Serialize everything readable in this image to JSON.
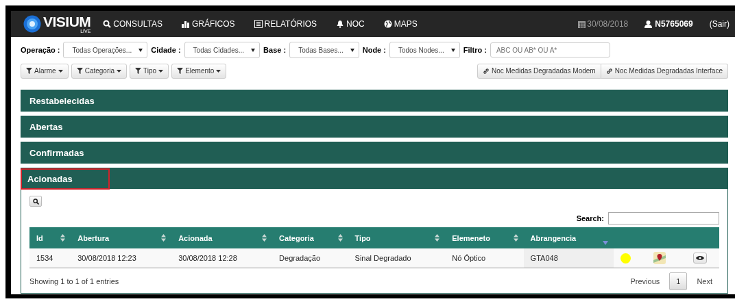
{
  "navbar": {
    "logo": {
      "name": "VISIUM",
      "sub": "LIVE"
    },
    "items": [
      "CONSULTAS",
      "GRÁFICOS",
      "RELATÓRIOS",
      "NOC",
      "MAPS"
    ],
    "date": "30/08/2018",
    "user": "N5765069",
    "logout": "(Sair)"
  },
  "filters": [
    {
      "label": "Operação :",
      "value": "Todas Operações..."
    },
    {
      "label": "Cidade :",
      "value": "Todas Cidades..."
    },
    {
      "label": "Base :",
      "value": "Todas Bases..."
    },
    {
      "label": "Node :",
      "value": "Todos Nodes..."
    }
  ],
  "filter_text": {
    "label": "Filtro :",
    "placeholder": "ABC OU AB* OU A*"
  },
  "dropdown_buttons": [
    "Alarme",
    "Categoria",
    "Tipo",
    "Elemento"
  ],
  "link_buttons": [
    "Noc Medidas Degradadas Modem",
    "Noc Medidas Degradadas Interface"
  ],
  "panels": [
    {
      "title": "Restabelecidas",
      "expanded": false,
      "highlighted": false
    },
    {
      "title": "Abertas",
      "expanded": false,
      "highlighted": false
    },
    {
      "title": "Confirmadas",
      "expanded": false,
      "highlighted": false
    },
    {
      "title": "Acionadas",
      "expanded": true,
      "highlighted": true
    }
  ],
  "table": {
    "search_label": "Search:",
    "columns": [
      {
        "label": "Id",
        "sorted": false
      },
      {
        "label": "Abertura",
        "sorted": false
      },
      {
        "label": "Acionada",
        "sorted": false
      },
      {
        "label": "Categoria",
        "sorted": false
      },
      {
        "label": "Tipo",
        "sorted": false
      },
      {
        "label": "Elemeneto",
        "sorted": false
      },
      {
        "label": "Abrangencia",
        "sorted": true
      }
    ],
    "rows": [
      {
        "cells": [
          "1534",
          "30/08/2018 12:23",
          "30/08/2018 12:28",
          "Degradação",
          "Sinal Degradado",
          "Nó Óptico",
          "GTA048"
        ],
        "color": "#ffff00"
      }
    ],
    "info": "Showing 1 to 1 of 1 entries",
    "pagination": [
      {
        "label": "Previous",
        "selected": false
      },
      {
        "label": "1",
        "selected": true
      },
      {
        "label": "Next",
        "selected": false
      }
    ]
  }
}
